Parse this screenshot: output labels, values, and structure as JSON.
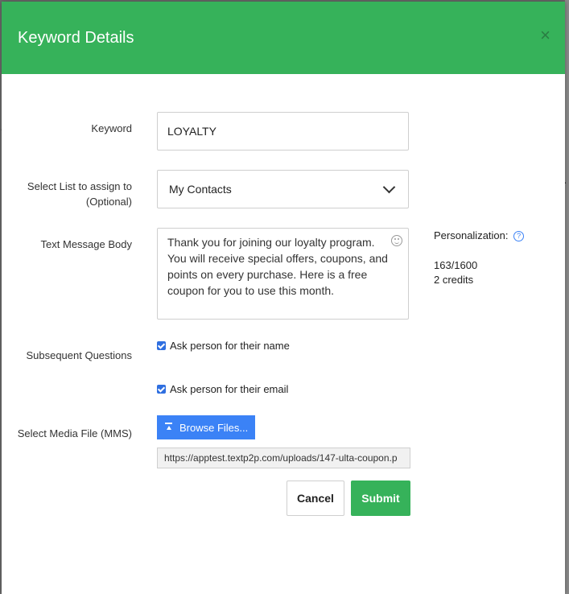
{
  "dialog": {
    "title": "Keyword Details",
    "close_label": "×"
  },
  "form": {
    "keyword": {
      "label": "Keyword",
      "value": "LOYALTY"
    },
    "list": {
      "label_line1": "Select List to assign to",
      "label_line2": "(Optional)",
      "selected": "My Contacts"
    },
    "message": {
      "label": "Text Message Body",
      "lines": [
        "Thank you for joining our loyalty program.",
        "You will receive special offers, coupons, and",
        "points on every purchase. Here is a free",
        "coupon for you to use this month."
      ]
    },
    "personalization_label": "Personalization:",
    "char_count": "163/1600",
    "credits": "2 credits",
    "questions": {
      "label": "Subsequent Questions",
      "ask_name": "Ask person for their name",
      "ask_email": "Ask person for their email"
    },
    "media": {
      "label": "Select Media File (MMS)",
      "browse_label": "Browse Files...",
      "url": "https://apptest.textp2p.com/uploads/147-ulta-coupon.p"
    }
  },
  "actions": {
    "cancel_label": "Cancel",
    "submit_label": "Submit"
  },
  "colors": {
    "header_green": "#36b25a",
    "primary_blue": "#3b82f6"
  }
}
